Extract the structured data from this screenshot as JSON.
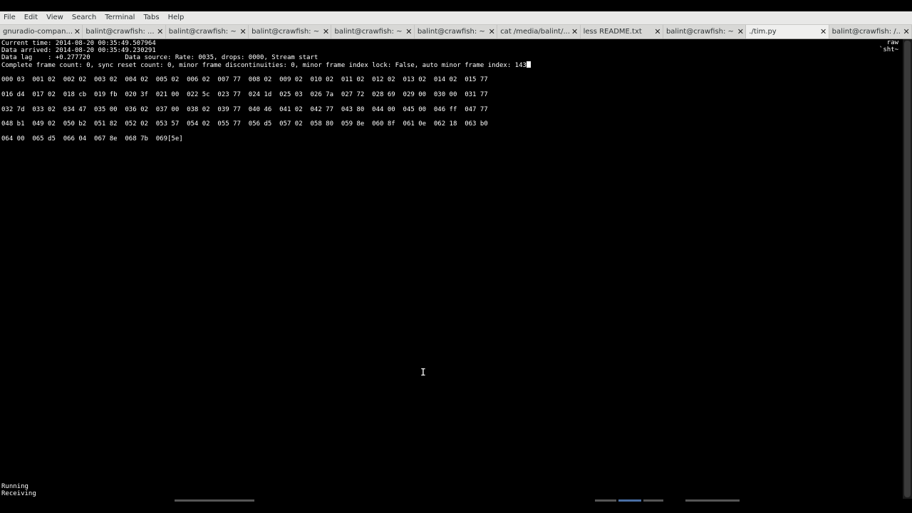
{
  "menu": [
    "File",
    "Edit",
    "View",
    "Search",
    "Terminal",
    "Tabs",
    "Help"
  ],
  "tabs": [
    {
      "label": "gnuradio-compan...",
      "active": false
    },
    {
      "label": "balint@crawfish: ...",
      "active": false
    },
    {
      "label": "balint@crawfish: ~",
      "active": false
    },
    {
      "label": "balint@crawfish: ~",
      "active": false
    },
    {
      "label": "balint@crawfish: ~",
      "active": false
    },
    {
      "label": "balint@crawfish: ~",
      "active": false
    },
    {
      "label": "cat /media/balint/...",
      "active": false
    },
    {
      "label": "less README.txt",
      "active": false
    },
    {
      "label": "balint@crawfish: ~",
      "active": false
    },
    {
      "label": "./tim.py",
      "active": true
    },
    {
      "label": "balint@crawfish: /...",
      "active": false
    }
  ],
  "tab_close_glyph": "✕",
  "terminal": {
    "header_lines": [
      "Current time: 2014-08-20 00:35:49.507964",
      "Data arrived: 2014-08-20 00:35:49.230291",
      "Data lag    : +0.277720         Data source: Rate: 0035, drops: 0000, Stream start",
      "Complete frame count: 0, sync reset count: 0, minor frame discontinuities: 0, minor frame index lock: False, auto minor frame index: 143"
    ],
    "side_label": "raw\n`sht~",
    "data_rows": [
      "000 03  001 02  002 02  003 02  004 02  005 02  006 02  007 77  008 02  009 02  010 02  011 02  012 02  013 02  014 02  015 77",
      "016 d4  017 02  018 cb  019 fb  020 3f  021 00  022 5c  023 77  024 1d  025 03  026 7a  027 72  028 69  029 00  030 00  031 77",
      "032 7d  033 02  034 47  035 00  036 02  037 00  038 02  039 77  040 46  041 02  042 77  043 80  044 00  045 00  046 ff  047 77",
      "048 b1  049 02  050 b2  051 82  052 02  053 57  054 02  055 77  056 d5  057 02  058 80  059 8e  060 8f  061 0e  062 18  063 b0",
      "064 00  065 d5  066 04  067 8e  068 7b  069[5e]"
    ],
    "status_lines": [
      "Running",
      "Receiving"
    ]
  },
  "icons": {
    "mouse_cursor": "text-cursor-icon"
  },
  "colors": {
    "background": "#000000",
    "foreground": "#ffffff",
    "menubar": "#e8e8e7",
    "tabbar": "#d8d8d6"
  }
}
